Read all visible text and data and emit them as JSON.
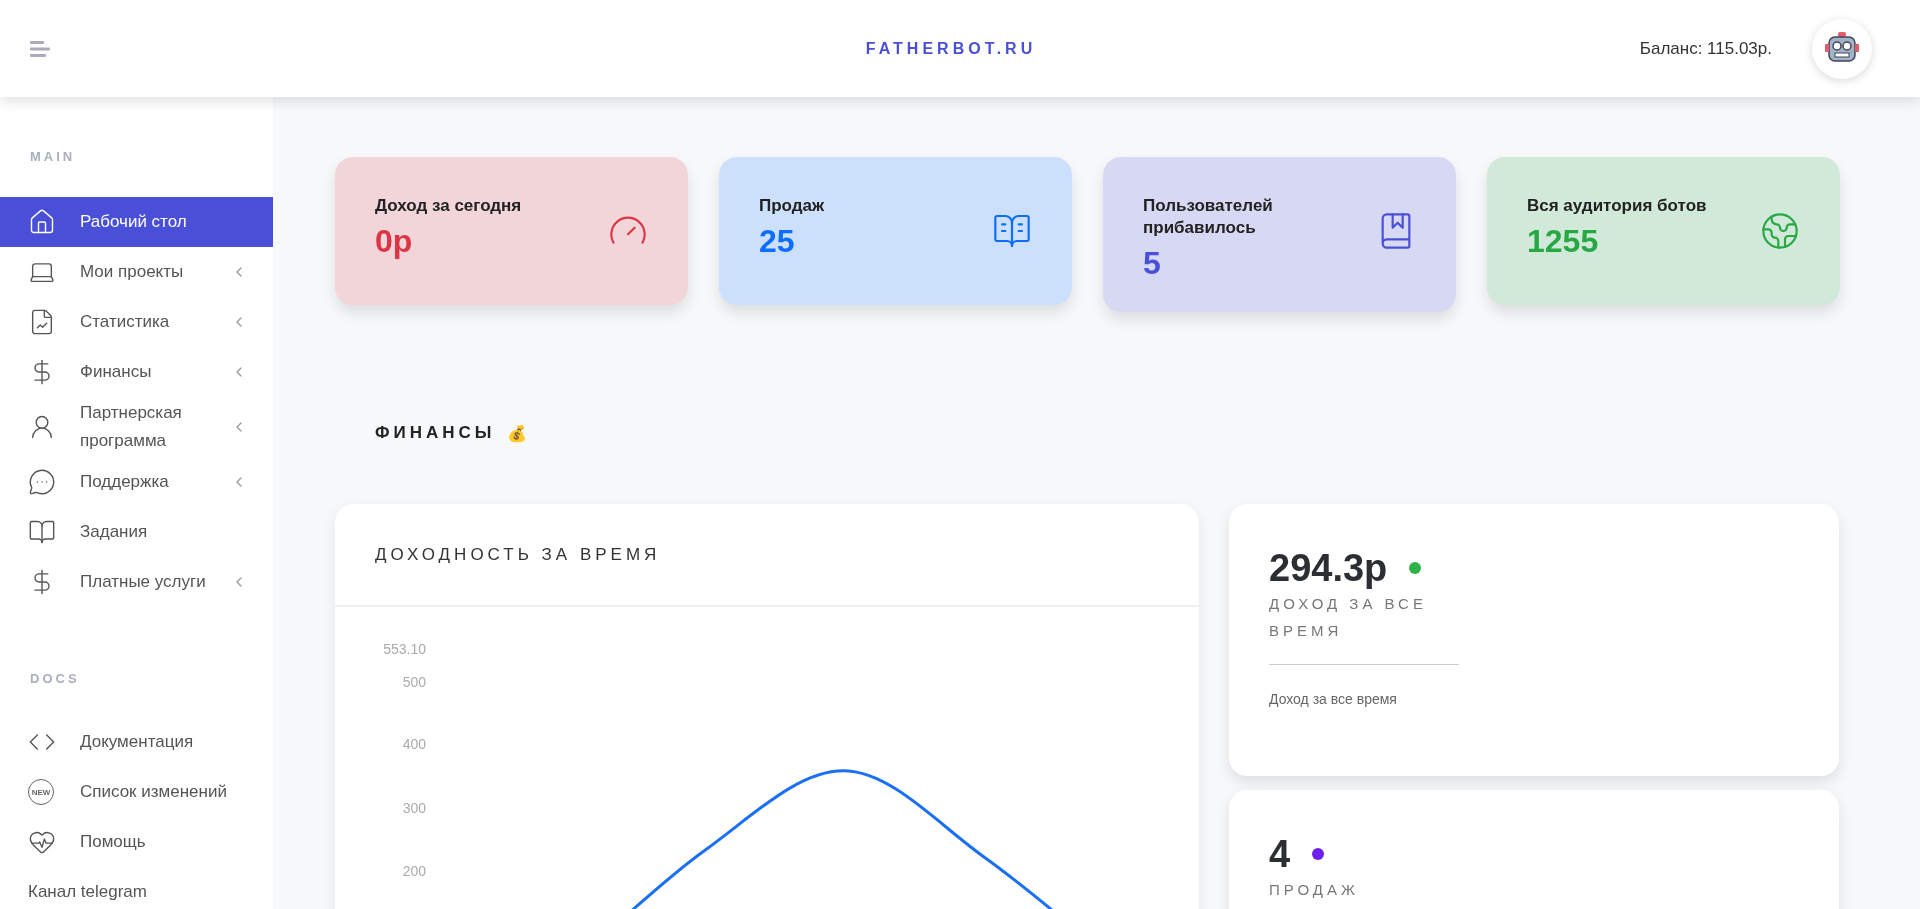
{
  "header": {
    "brand": "FATHERBOT.RU",
    "balance": "Баланс: 115.03р."
  },
  "sidebar": {
    "sections": [
      {
        "title": "MAIN",
        "items": [
          {
            "label": "Рабочий стол",
            "selected": true,
            "expandable": false
          },
          {
            "label": "Мои проекты",
            "selected": false,
            "expandable": true
          },
          {
            "label": "Статистика",
            "selected": false,
            "expandable": true
          },
          {
            "label": "Финансы",
            "selected": false,
            "expandable": true
          },
          {
            "label": "Партнерская программа",
            "selected": false,
            "expandable": true
          },
          {
            "label": "Поддержка",
            "selected": false,
            "expandable": true
          },
          {
            "label": "Задания",
            "selected": false,
            "expandable": false
          },
          {
            "label": "Платные услуги",
            "selected": false,
            "expandable": true
          }
        ]
      },
      {
        "title": "DOCS",
        "items": [
          {
            "label": "Документация",
            "selected": false,
            "expandable": false
          },
          {
            "badge": "NEW",
            "label": "Список изменений",
            "selected": false,
            "expandable": false
          },
          {
            "label": "Помощь",
            "selected": false,
            "expandable": false
          },
          {
            "label": "Канал telegram",
            "selected": false,
            "expandable": false
          }
        ]
      }
    ]
  },
  "stats": [
    {
      "title": "Доход за сегодня",
      "value": "0р",
      "color": "#dc3545"
    },
    {
      "title": "Продаж",
      "value": "25",
      "color": "#0d6efd"
    },
    {
      "title": "Пользователей прибавилось",
      "value": "5",
      "color": "#4a4fd8"
    },
    {
      "title": "Вся аудитория ботов",
      "value": "1255",
      "color": "#28a745"
    }
  ],
  "finance": {
    "heading": "ФИНАНСЫ",
    "emoji": "💰",
    "chart": {
      "title": "ДОХОДНОСТЬ ЗА ВРЕМЯ",
      "axis_labels": [
        "553.10",
        "500",
        "400",
        "300",
        "200"
      ]
    },
    "summary": [
      {
        "value": "294.3р",
        "color": "#2db34a",
        "label": "ДОХОД ЗА ВСЕ ВРЕМЯ",
        "note": "Доход за все время"
      },
      {
        "value": "4",
        "color": "#6f1ff0",
        "label": "ПРОДАЖ"
      }
    ]
  }
}
